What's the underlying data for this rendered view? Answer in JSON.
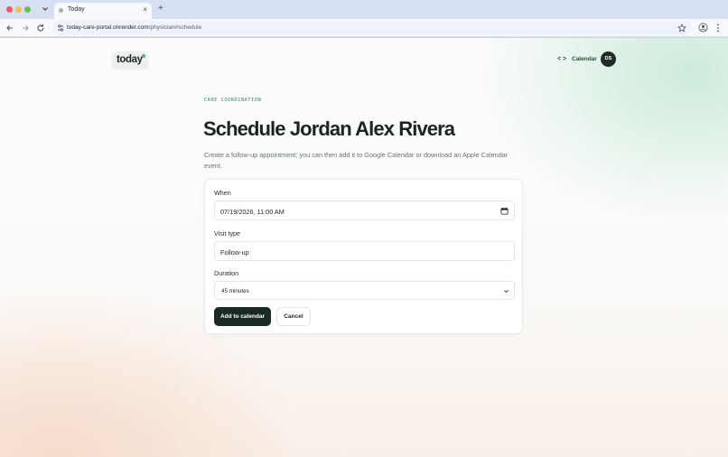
{
  "browser": {
    "tab_title": "Today",
    "tab_close": "×",
    "new_tab": "+",
    "url_domain": "today-care-portal.onrender.com",
    "url_path": "/physician#schedule"
  },
  "header": {
    "logo_text": "today",
    "code_icon_text": "< >",
    "nav_calendar": "Calendar",
    "avatar_initials": "DS"
  },
  "main": {
    "eyebrow": "CARE COORDINATION",
    "title": "Schedule Jordan Alex Rivera",
    "subtitle": "Create a follow-up appointment; you can then add it to Google Calendar or download an Apple Calendar event."
  },
  "form": {
    "when_label": "When",
    "when_value": "07/19/2026, 11:00 AM",
    "visit_type_label": "Visit type",
    "visit_type_value": "Follow-up",
    "duration_label": "Duration",
    "duration_value": "45 minutes",
    "submit_label": "Add to calendar",
    "cancel_label": "Cancel"
  },
  "colors": {
    "accent_dark": "#1b2a24",
    "eyebrow_green": "#3f7a62",
    "logo_dot": "#4fb58c"
  },
  "icons": [
    "tab-list-icon",
    "back-icon",
    "forward-icon",
    "reload-icon",
    "site-info-icon",
    "bookmark-star-icon",
    "profile-icon",
    "menu-kebab-icon",
    "code-icon",
    "calendar-icon",
    "chevron-down-icon"
  ]
}
